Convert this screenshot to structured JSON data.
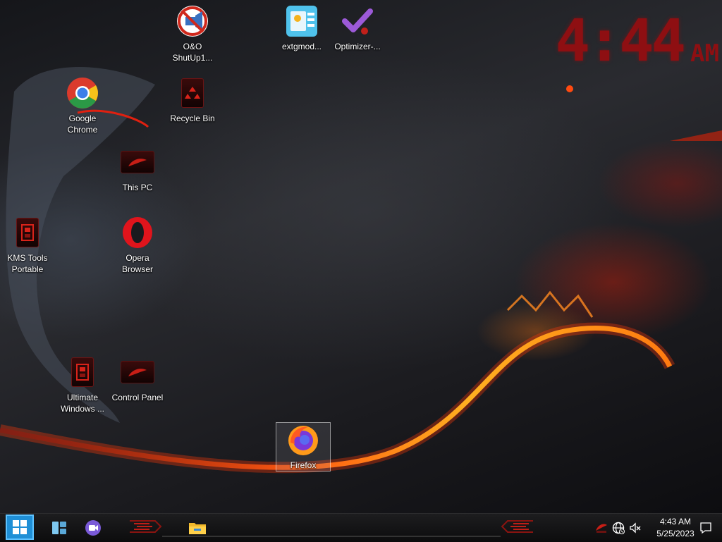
{
  "desktop": {
    "clock_widget": {
      "time": "4:44",
      "ampm": "AM"
    },
    "icons": [
      {
        "label": "O&O ShutUp1..."
      },
      {
        "label": "extgmod..."
      },
      {
        "label": "Optimizer-..."
      },
      {
        "label": "Google Chrome"
      },
      {
        "label": "Recycle Bin"
      },
      {
        "label": "This PC"
      },
      {
        "label": "KMS Tools Portable"
      },
      {
        "label": "Opera Browser"
      },
      {
        "label": "Ultimate Windows ..."
      },
      {
        "label": "Control Panel"
      },
      {
        "label": "Firefox"
      }
    ]
  },
  "taskbar": {
    "clock": {
      "time": "4:43 AM",
      "date": "5/25/2023"
    }
  },
  "colors": {
    "accent_red": "#8e0f12",
    "start_blue": "#1f8fd6",
    "taskbar_bg": "#111112"
  },
  "icon_names": [
    "oo-shutup-icon",
    "extgmod-icon",
    "optimizer-icon",
    "chrome-icon",
    "recycle-bin-icon",
    "this-pc-icon",
    "kms-tools-icon",
    "opera-icon",
    "ultimate-windows-icon",
    "control-panel-icon",
    "firefox-icon",
    "start-icon",
    "task-view-icon",
    "meet-icon",
    "file-explorer-icon",
    "msi-tray-icon",
    "network-icon",
    "volume-muted-icon",
    "notification-icon"
  ]
}
